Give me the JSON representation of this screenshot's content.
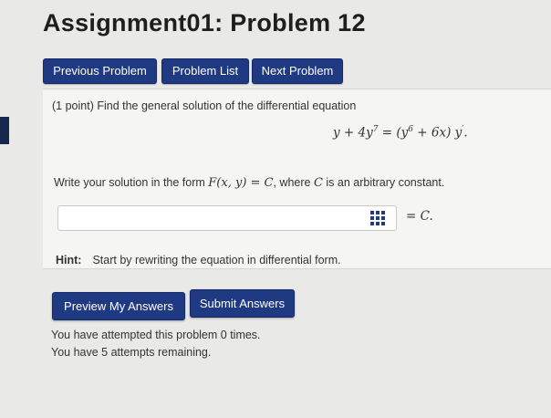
{
  "page": {
    "title": "Assignment01: Problem 12"
  },
  "nav": {
    "previous_label": "Previous Problem",
    "list_label": "Problem List",
    "next_label": "Next Problem"
  },
  "problem": {
    "intro": "(1 point) Find the general solution of the differential equation",
    "instruction_prefix": "Write your solution in the form ",
    "instruction_math_form": "F(x, y) = C",
    "instruction_mid": ", where ",
    "instruction_math_c": "C",
    "instruction_suffix": " is an arbitrary constant.",
    "answer_value": "",
    "answer_suffix": "= C.",
    "hint_label": "Hint:",
    "hint_text": "Start by rewriting the equation in differential form."
  },
  "actions": {
    "preview_label": "Preview My Answers",
    "submit_label": "Submit Answers"
  },
  "status": {
    "attempted": "You have attempted this problem 0 times.",
    "remaining": "You have 5 attempts remaining."
  },
  "colors": {
    "button_bg": "#1f3a82",
    "page_bg": "#e9e9e7",
    "panel_bg": "#f5f5f3"
  },
  "icons": {
    "answer_helper": "grid-icon"
  }
}
